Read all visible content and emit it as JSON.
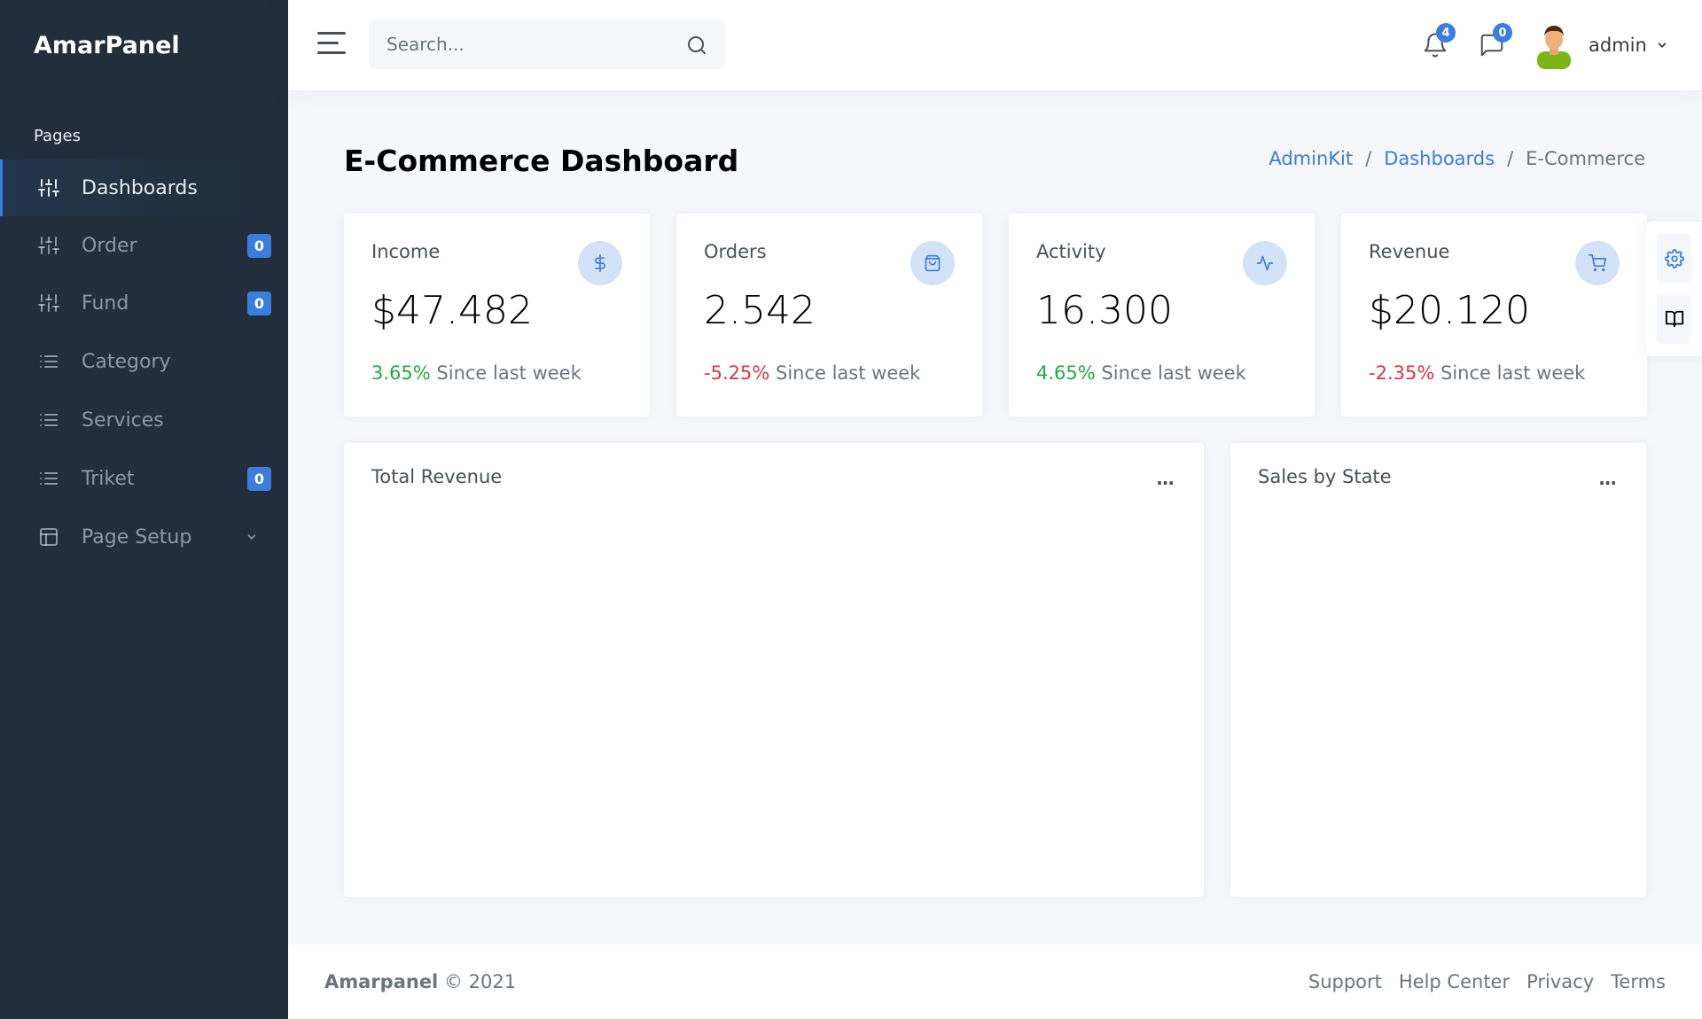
{
  "sidebar": {
    "brand": "AmarPanel",
    "header": "Pages",
    "items": [
      {
        "label": "Dashboards",
        "icon": "sliders-icon",
        "active": true
      },
      {
        "label": "Order",
        "icon": "sliders-icon",
        "badge": "0"
      },
      {
        "label": "Fund",
        "icon": "sliders-icon",
        "badge": "0"
      },
      {
        "label": "Category",
        "icon": "list-icon"
      },
      {
        "label": "Services",
        "icon": "list-icon"
      },
      {
        "label": "Triket",
        "icon": "list-icon",
        "badge": "0"
      },
      {
        "label": "Page Setup",
        "icon": "layout-icon",
        "has_dropdown": true
      }
    ]
  },
  "navbar": {
    "search_placeholder": "Search...",
    "notifications_count": "4",
    "messages_count": "0",
    "user_name": "admin"
  },
  "page": {
    "title_bold": "E-Commerce",
    "title_rest": "Dashboard",
    "breadcrumb": [
      "AdminKit",
      "Dashboards",
      "E-Commerce"
    ]
  },
  "stats": [
    {
      "title": "Income",
      "value": "$47.482",
      "change": "3.65%",
      "change_type": "positive",
      "caption": "Since last week",
      "icon": "dollar-icon"
    },
    {
      "title": "Orders",
      "value": "2.542",
      "change": "-5.25%",
      "change_type": "negative",
      "caption": "Since last week",
      "icon": "shopping-bag-icon"
    },
    {
      "title": "Activity",
      "value": "16.300",
      "change": "4.65%",
      "change_type": "positive",
      "caption": "Since last week",
      "icon": "activity-icon"
    },
    {
      "title": "Revenue",
      "value": "$20.120",
      "change": "-2.35%",
      "change_type": "negative",
      "caption": "Since last week",
      "icon": "shopping-cart-icon"
    }
  ],
  "panels": {
    "revenue": {
      "title": "Total Revenue",
      "menu": "..."
    },
    "sales": {
      "title": "Sales by State",
      "menu": "..."
    }
  },
  "footer": {
    "brand": "Amarpanel",
    "copyright": "© 2021",
    "links": [
      "Support",
      "Help Center",
      "Privacy",
      "Terms"
    ]
  },
  "colors": {
    "sidebar_bg": "#222e3c",
    "accent": "#3b7ddd",
    "positive": "#28a745",
    "negative": "#dc3545",
    "page_bg": "#f5f7fb"
  }
}
